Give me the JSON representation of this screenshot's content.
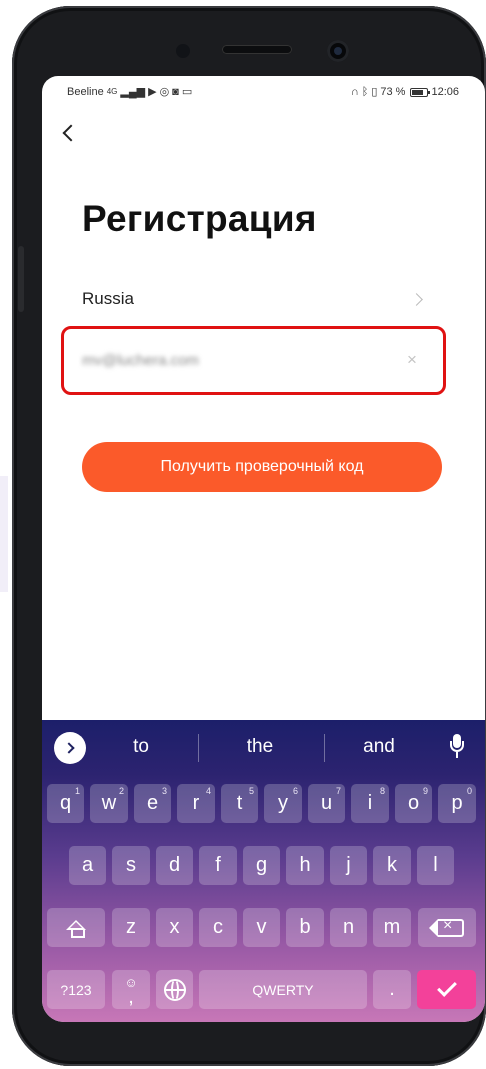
{
  "status_bar": {
    "carrier": "Beeline",
    "network": "4G",
    "battery_percent": "73 %",
    "time": "12:06"
  },
  "page": {
    "title": "Регистрация",
    "country": "Russia",
    "email_value": "mv@luchera.com",
    "clear_symbol": "×",
    "submit_label": "Получить проверочный код"
  },
  "keyboard": {
    "suggestions": [
      "to",
      "the",
      "and"
    ],
    "row1": [
      {
        "key": "q",
        "hint": "1"
      },
      {
        "key": "w",
        "hint": "2"
      },
      {
        "key": "e",
        "hint": "3"
      },
      {
        "key": "r",
        "hint": "4"
      },
      {
        "key": "t",
        "hint": "5"
      },
      {
        "key": "y",
        "hint": "6"
      },
      {
        "key": "u",
        "hint": "7"
      },
      {
        "key": "i",
        "hint": "8"
      },
      {
        "key": "o",
        "hint": "9"
      },
      {
        "key": "p",
        "hint": "0"
      }
    ],
    "row2": [
      "a",
      "s",
      "d",
      "f",
      "g",
      "h",
      "j",
      "k",
      "l"
    ],
    "row3": [
      "z",
      "x",
      "c",
      "v",
      "b",
      "n",
      "m"
    ],
    "symbols_label": "?123",
    "comma_label": ",",
    "space_label": "QWERTY",
    "period_label": "."
  },
  "colors": {
    "accent": "#fb5a2a",
    "highlight": "#e01212",
    "enter_key": "#f3419a"
  }
}
